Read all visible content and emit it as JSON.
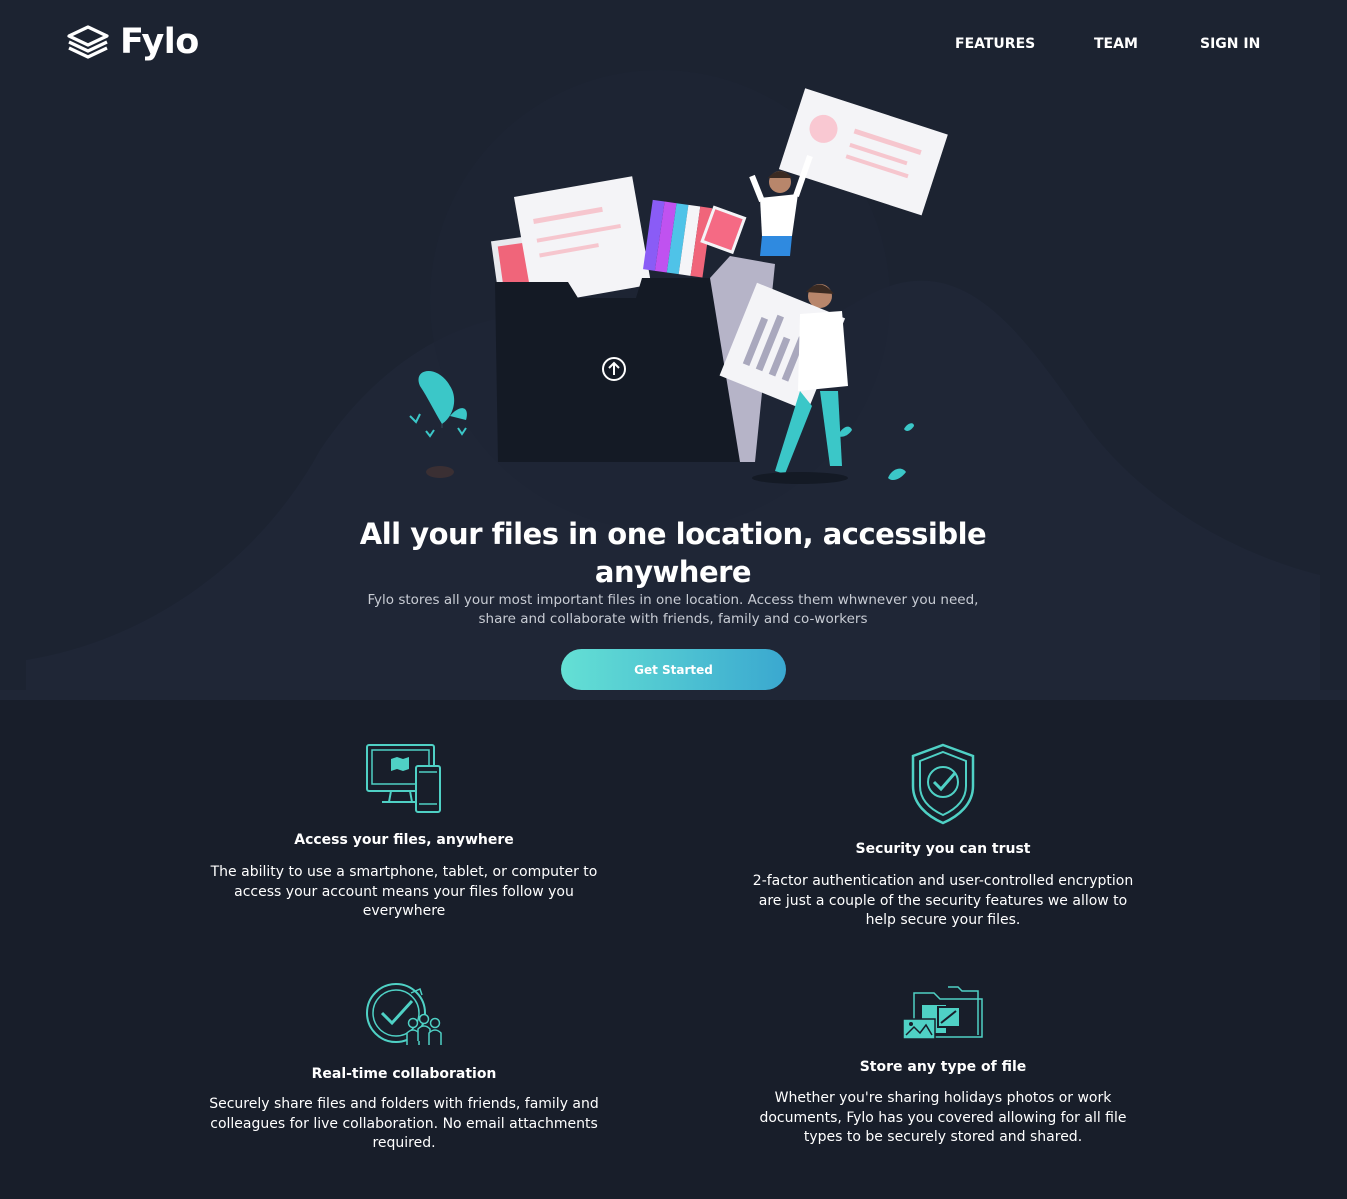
{
  "colors": {
    "page_bg": "#181e2a",
    "hero_bg": "#1c2331",
    "accent_teal": "#64e0d4",
    "accent_blue": "#3aa8d0",
    "icon_stroke": "#4fd1c5"
  },
  "header": {
    "logo_text": "Fylo",
    "logo_icon": "stacked-layers-icon",
    "nav": [
      {
        "label": "FEATURES"
      },
      {
        "label": "TEAM"
      },
      {
        "label": "SIGN IN"
      }
    ]
  },
  "hero": {
    "illustration": "people-with-folder-and-files-illustration",
    "title": "All your files in one location, accessible anywhere",
    "subtitle": "Fylo stores all your most important files in one location. Access them whwnever you need, share and collaborate with friends, family and co-workers",
    "cta_label": "Get Started"
  },
  "features": [
    {
      "icon": "devices-icon",
      "title": "Access your files, anywhere",
      "text": "The ability to use a smartphone, tablet, or computer to access your account means your files follow you everywhere"
    },
    {
      "icon": "shield-check-icon",
      "title": "Security you can trust",
      "text": "2-factor authentication and user-controlled encryption are just a couple of the security features we allow to help secure your files."
    },
    {
      "icon": "collaboration-icon",
      "title": "Real-time collaboration",
      "text": "Securely share files and folders with friends, family and colleagues for live collaboration. No email attachments required."
    },
    {
      "icon": "file-types-icon",
      "title": "Store any type of file",
      "text": "Whether you're sharing holidays photos or work documents, Fylo has you covered allowing for all file types to be securely stored and shared."
    }
  ]
}
